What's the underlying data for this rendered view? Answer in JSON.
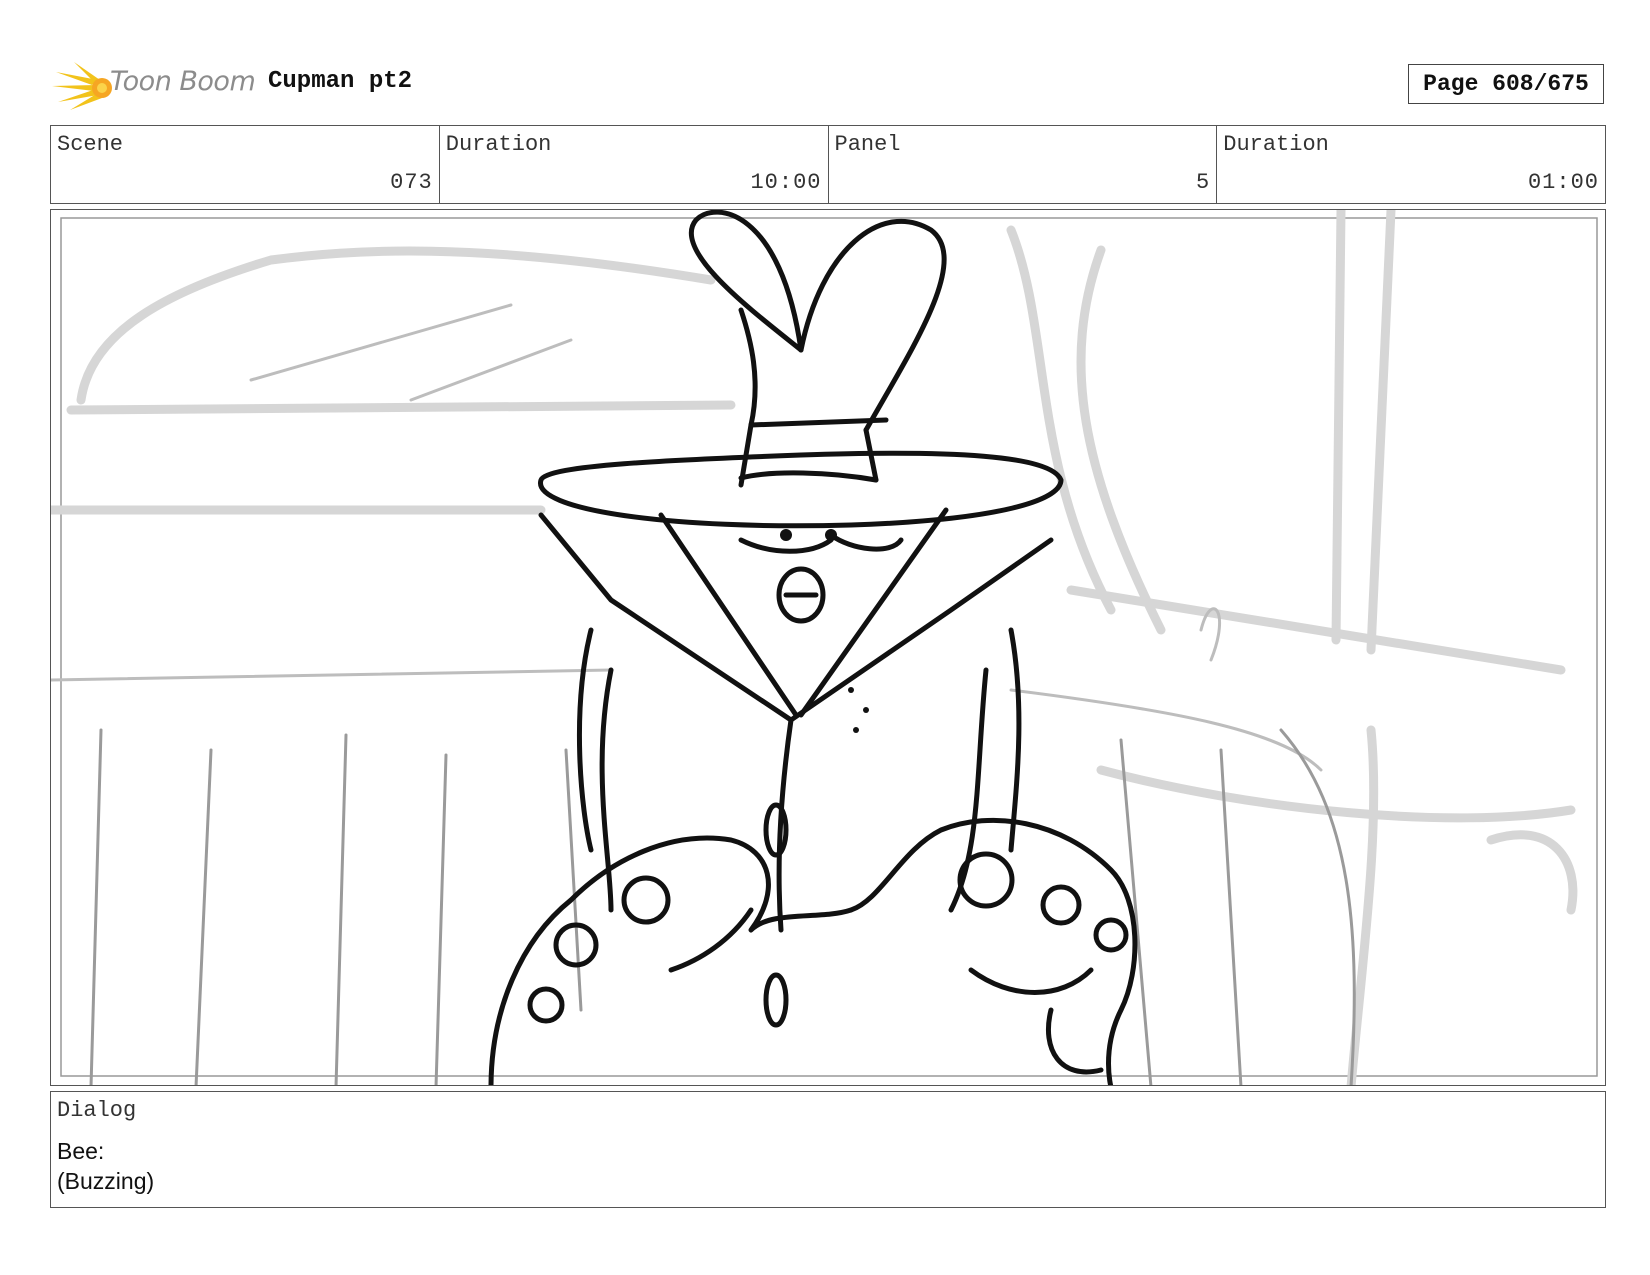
{
  "header": {
    "logo_text": "Toon Boom",
    "project_title": "Cupman pt2",
    "page_label": "Page 608/675"
  },
  "info": {
    "scene_label": "Scene",
    "scene_value": "073",
    "scene_duration_label": "Duration",
    "scene_duration_value": "10:00",
    "panel_label": "Panel",
    "panel_value": "5",
    "panel_duration_label": "Duration",
    "panel_duration_value": "01:00"
  },
  "dialog": {
    "label": "Dialog",
    "lines": [
      "Bee:",
      "(Buzzing)"
    ]
  }
}
